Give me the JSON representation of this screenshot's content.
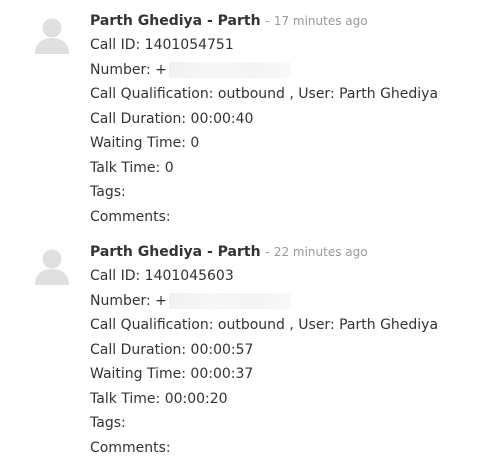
{
  "entries": [
    {
      "author": "Parth Ghediya - Parth",
      "separator": "-",
      "time": "17 minutes ago",
      "call_id": "Call ID: 1401054751",
      "number_label": "Number: +",
      "qualification": "Call Qualification: outbound , User: Parth Ghediya",
      "duration": "Call Duration: 00:00:40",
      "waiting": "Waiting Time: 0",
      "talk": "Talk Time: 0",
      "tags": "Tags:",
      "comments": "Comments:"
    },
    {
      "author": "Parth Ghediya - Parth",
      "separator": "-",
      "time": "22 minutes ago",
      "call_id": "Call ID: 1401045603",
      "number_label": "Number: +",
      "qualification": "Call Qualification: outbound , User: Parth Ghediya",
      "duration": "Call Duration: 00:00:57",
      "waiting": "Waiting Time: 00:00:37",
      "talk": "Talk Time: 00:00:20",
      "tags": "Tags:",
      "comments": "Comments:"
    }
  ],
  "colors": {
    "text": "#333333",
    "muted": "#9a9a9a",
    "avatar": "#e0e0e0"
  },
  "icons": {
    "avatar": "user-silhouette-icon"
  }
}
